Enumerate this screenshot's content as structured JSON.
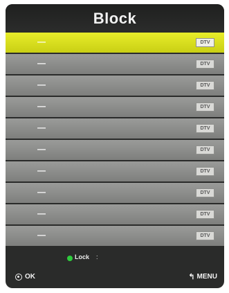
{
  "title": "Block",
  "rows": [
    {
      "name": "—",
      "badge": "DTV",
      "selected": true
    },
    {
      "name": "—",
      "badge": "DTV",
      "selected": false
    },
    {
      "name": "—",
      "badge": "DTV",
      "selected": false
    },
    {
      "name": "—",
      "badge": "DTV",
      "selected": false
    },
    {
      "name": "—",
      "badge": "DTV",
      "selected": false
    },
    {
      "name": "—",
      "badge": "DTV",
      "selected": false
    },
    {
      "name": "—",
      "badge": "DTV",
      "selected": false
    },
    {
      "name": "—",
      "badge": "DTV",
      "selected": false
    },
    {
      "name": "—",
      "badge": "DTV",
      "selected": false
    },
    {
      "name": "—",
      "badge": "DTV",
      "selected": false
    }
  ],
  "legend": {
    "label": "Lock",
    "separator": ":",
    "dot_color": "#2ecc3d",
    "icon": "green-dot-icon"
  },
  "footer": {
    "ok_label": "OK",
    "ok_icon": "ok-circle-icon",
    "menu_label": "MENU",
    "menu_icon": "return-arrow-icon"
  },
  "colors": {
    "selected_row": "#e0e522",
    "row": "#8c8d8b",
    "panel": "#2a2b2a"
  }
}
